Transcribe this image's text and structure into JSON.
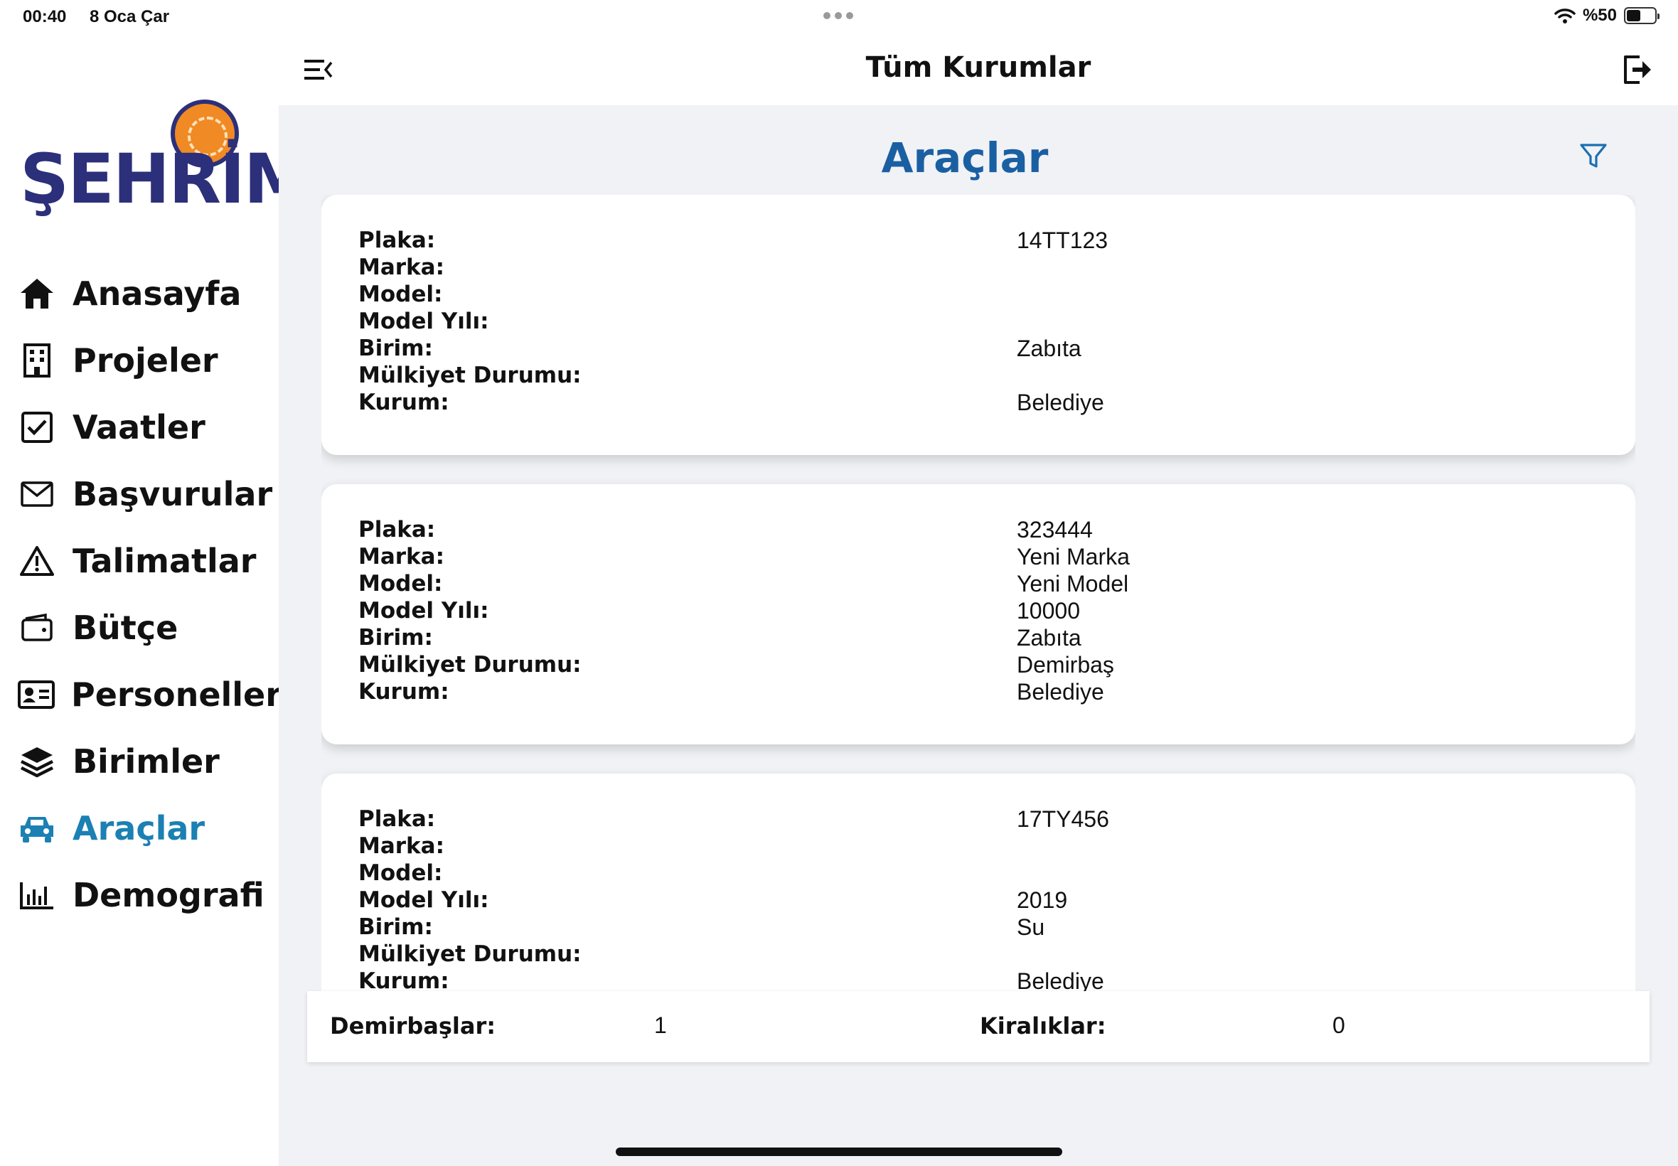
{
  "status_bar": {
    "time": "00:40",
    "date": "8 Oca Çar",
    "battery": "%50",
    "battery_level": 0.5
  },
  "logo": {
    "text": "ŞEHRİM"
  },
  "nav": {
    "items": [
      {
        "label": "Anasayfa",
        "icon": "home-icon"
      },
      {
        "label": "Projeler",
        "icon": "building-icon"
      },
      {
        "label": "Vaatler",
        "icon": "checkbox-icon"
      },
      {
        "label": "Başvurular",
        "icon": "envelope-icon"
      },
      {
        "label": "Talimatlar",
        "icon": "warning-icon"
      },
      {
        "label": "Bütçe",
        "icon": "wallet-icon"
      },
      {
        "label": "Personeller",
        "icon": "id-card-icon"
      },
      {
        "label": "Birimler",
        "icon": "layers-icon"
      },
      {
        "label": "Araçlar",
        "icon": "car-icon",
        "active": true
      },
      {
        "label": "Demografi",
        "icon": "bar-chart-icon"
      }
    ],
    "active_color": "#1b80b3"
  },
  "header": {
    "title": "Tüm Kurumlar"
  },
  "page": {
    "title": "Araçlar",
    "title_color": "#1b5fa3"
  },
  "field_labels": {
    "plaka": "Plaka:",
    "marka": "Marka:",
    "model": "Model:",
    "model_yili": "Model Yılı:",
    "birim": "Birim:",
    "mulkiyet": "Mülkiyet Durumu:",
    "kurum": "Kurum:"
  },
  "vehicles": [
    {
      "plaka": "14TT123",
      "marka": "",
      "model": "",
      "model_yili": "",
      "birim": "Zabıta",
      "mulkiyet": "",
      "kurum": "Belediye"
    },
    {
      "plaka": "323444",
      "marka": "Yeni Marka",
      "model": "Yeni Model",
      "model_yili": "10000",
      "birim": "Zabıta",
      "mulkiyet": "Demirbaş",
      "kurum": "Belediye"
    },
    {
      "plaka": "17TY456",
      "marka": "",
      "model": "",
      "model_yili": "2019",
      "birim": "Su",
      "mulkiyet": "",
      "kurum": "Belediye"
    }
  ],
  "summary": {
    "demirbas_label": "Demirbaşlar:",
    "demirbas_value": "1",
    "kiralik_label": "Kiralıklar:",
    "kiralik_value": "0"
  }
}
